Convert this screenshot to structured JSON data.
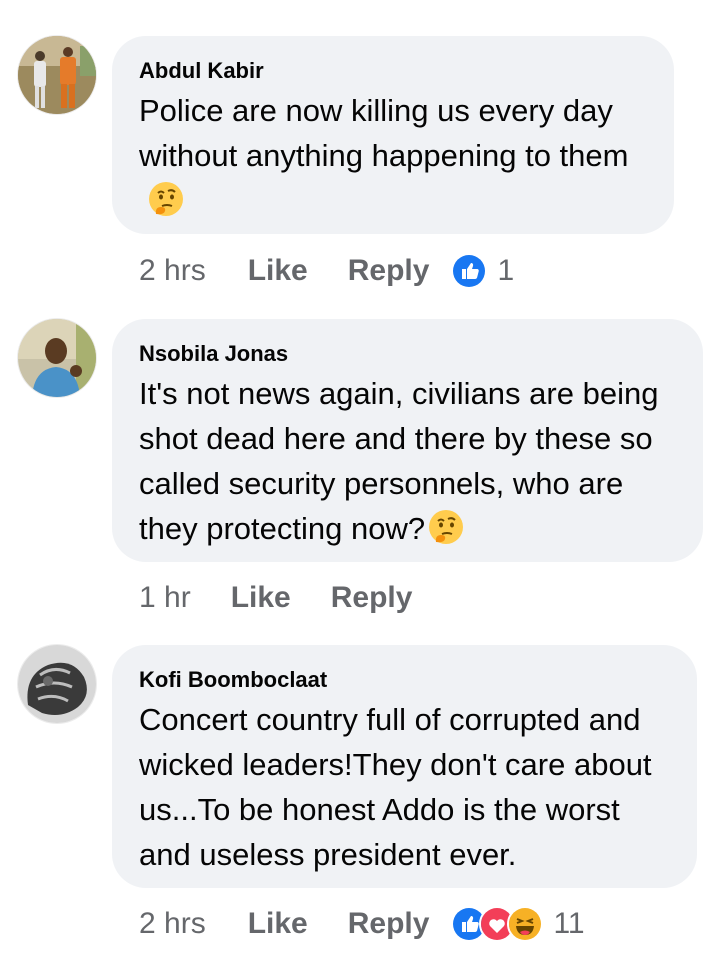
{
  "colors": {
    "bubble": "#f0f2f5",
    "meta_text": "#65676b",
    "like_blue": "#1877f2",
    "love_red": "#f33e58",
    "haha_yellow": "#f7b125"
  },
  "comments": [
    {
      "author": "Abdul Kabir",
      "text": "Police are now killing us every day without anything happening to them",
      "emoji": "thinking-face",
      "time": "2 hrs",
      "like_label": "Like",
      "reply_label": "Reply",
      "reactions": [
        "like"
      ],
      "reaction_count": "1"
    },
    {
      "author": "Nsobila Jonas",
      "text": "It's not news again, civilians are being shot dead here and there by these so called security personnels, who are they protecting now?",
      "emoji": "thinking-face",
      "time": "1 hr",
      "like_label": "Like",
      "reply_label": "Reply",
      "reactions": [],
      "reaction_count": ""
    },
    {
      "author": "Kofi Boomboclaat",
      "text": "Concert country full of corrupted and wicked leaders!They don't care about us...To be honest Addo is the worst and useless president ever.",
      "emoji": "",
      "time": "2 hrs",
      "like_label": "Like",
      "reply_label": "Reply",
      "reactions": [
        "like",
        "love",
        "haha"
      ],
      "reaction_count": "11"
    }
  ]
}
